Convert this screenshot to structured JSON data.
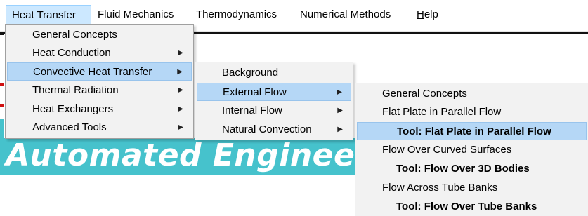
{
  "menubar": {
    "items": [
      {
        "label": "Heat Transfer"
      },
      {
        "label": "Fluid Mechanics"
      },
      {
        "label": "Thermodynamics"
      },
      {
        "label": "Numerical Methods"
      },
      {
        "label_mnemonic": "H",
        "label_rest": "elp"
      }
    ]
  },
  "menu_heat_transfer": {
    "items": [
      {
        "label": "General Concepts"
      },
      {
        "label": "Heat Conduction",
        "arrow": "▶"
      },
      {
        "label": "Convective Heat Transfer",
        "arrow": "▶"
      },
      {
        "label": "Thermal Radiation",
        "arrow": "▶"
      },
      {
        "label": "Heat Exchangers",
        "arrow": "▶"
      },
      {
        "label": "Advanced Tools",
        "arrow": "▶"
      }
    ]
  },
  "menu_convective": {
    "items": [
      {
        "label": "Background"
      },
      {
        "label": "External Flow",
        "arrow": "▶"
      },
      {
        "label": "Internal Flow",
        "arrow": "▶"
      },
      {
        "label": "Natural Convection",
        "arrow": "▶"
      }
    ]
  },
  "menu_external_flow": {
    "items": [
      {
        "label": "General Concepts"
      },
      {
        "label": "Flat Plate in Parallel Flow"
      },
      {
        "label": "Tool: Flat Plate in Parallel Flow"
      },
      {
        "label": "Flow Over Curved Surfaces"
      },
      {
        "label": "Tool: Flow Over 3D Bodies"
      },
      {
        "label": "Flow Across Tube Banks"
      },
      {
        "label": "Tool: Flow Over Tube Banks"
      }
    ]
  },
  "banner": {
    "text": "Automated Engineering"
  },
  "colors": {
    "highlight": "#b5d7f6",
    "banner": "#46c2cc",
    "menu_bg": "#f2f2f2"
  }
}
